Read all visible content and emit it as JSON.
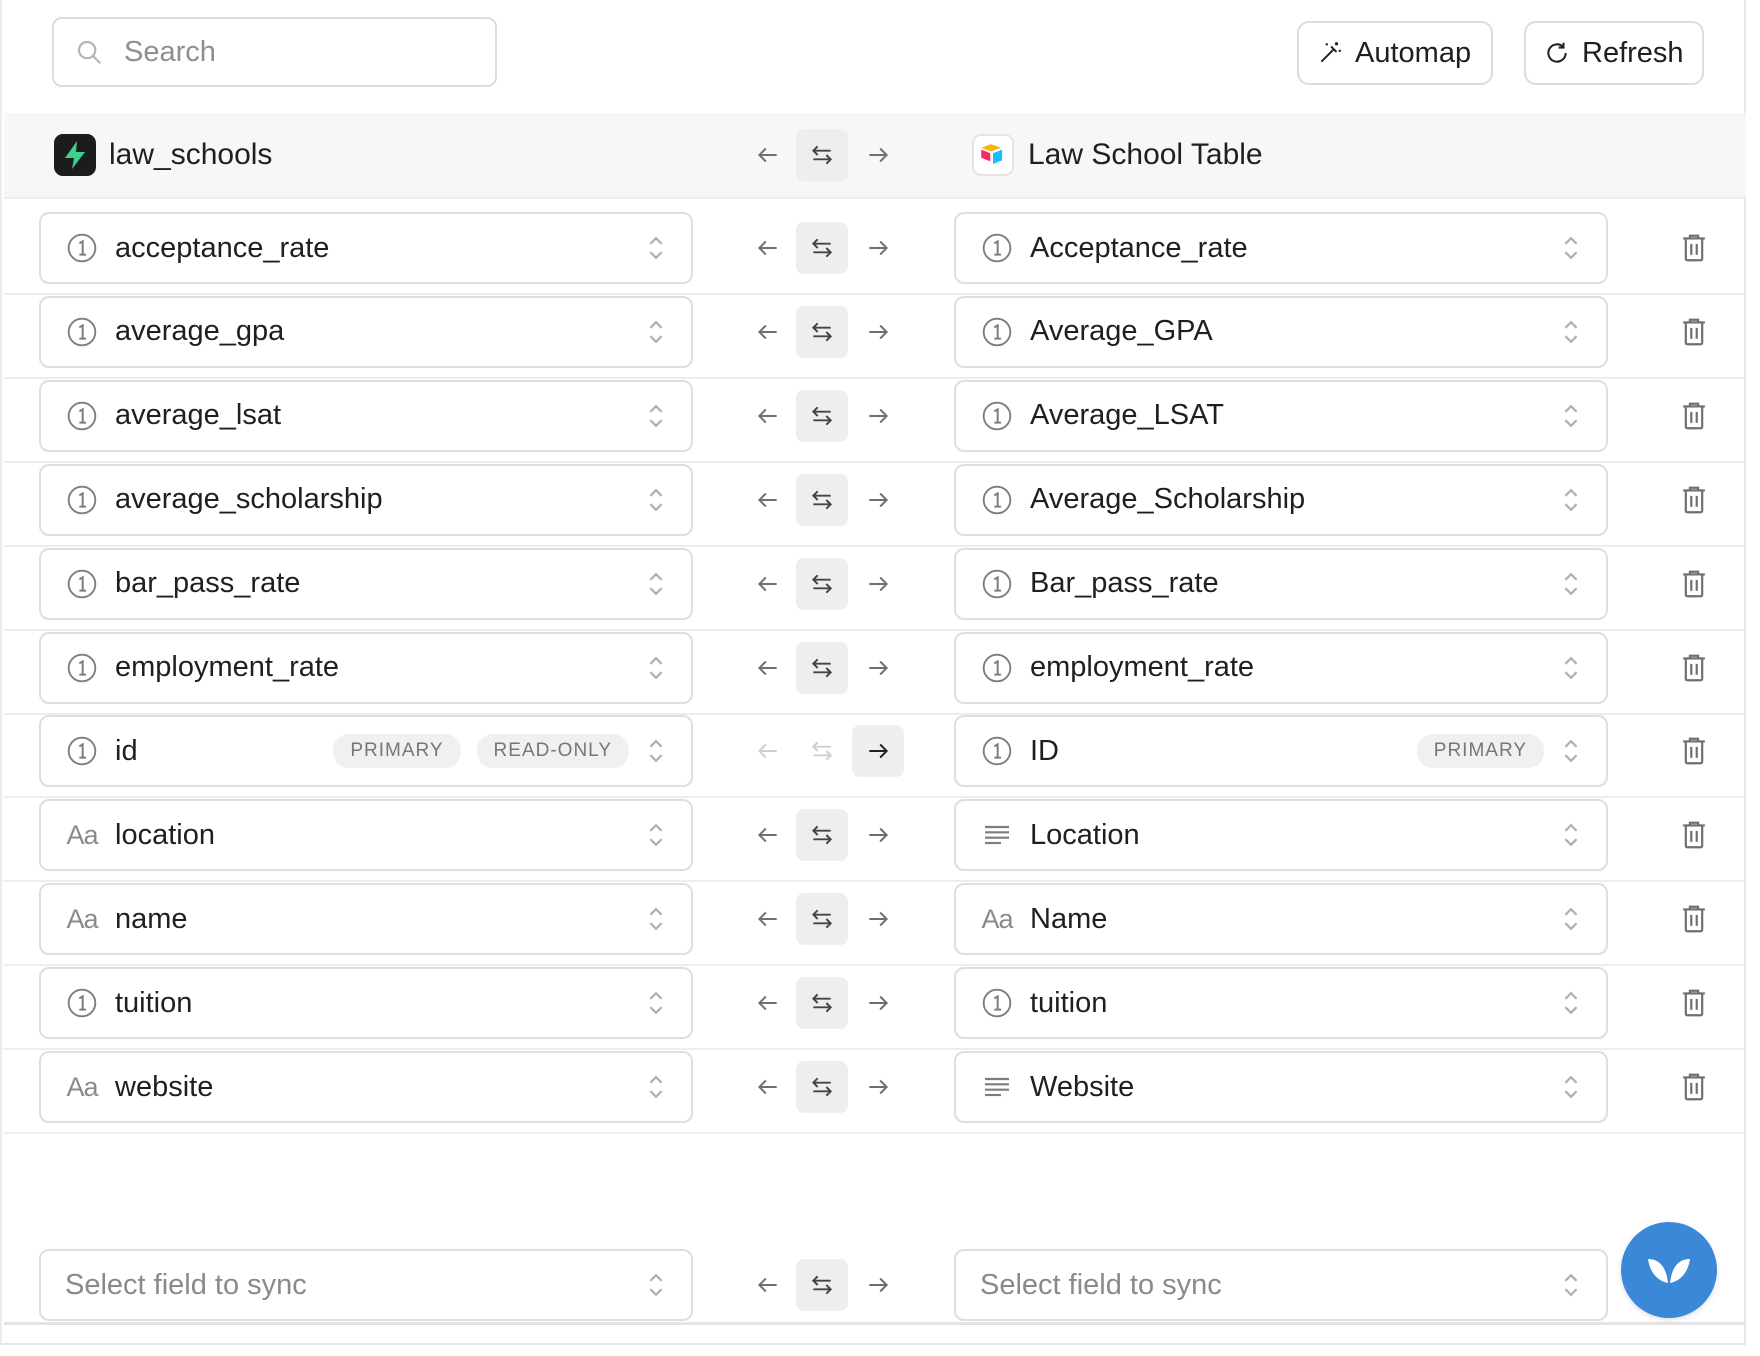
{
  "toolbar": {
    "search_placeholder": "Search",
    "automap_label": "Automap",
    "refresh_label": "Refresh"
  },
  "header": {
    "source_name": "law_schools",
    "destination_name": "Law School Table"
  },
  "rows": [
    {
      "left": {
        "type": "number",
        "name": "acceptance_rate"
      },
      "right": {
        "type": "number",
        "name": "Acceptance_rate"
      }
    },
    {
      "left": {
        "type": "number",
        "name": "average_gpa"
      },
      "right": {
        "type": "number",
        "name": "Average_GPA"
      }
    },
    {
      "left": {
        "type": "number",
        "name": "average_lsat"
      },
      "right": {
        "type": "number",
        "name": "Average_LSAT"
      }
    },
    {
      "left": {
        "type": "number",
        "name": "average_scholarship"
      },
      "right": {
        "type": "number",
        "name": "Average_Scholarship"
      }
    },
    {
      "left": {
        "type": "number",
        "name": "bar_pass_rate"
      },
      "right": {
        "type": "number",
        "name": "Bar_pass_rate"
      }
    },
    {
      "left": {
        "type": "number",
        "name": "employment_rate"
      },
      "right": {
        "type": "number",
        "name": "employment_rate"
      }
    },
    {
      "left": {
        "type": "number",
        "name": "id",
        "badges": [
          "PRIMARY",
          "READ-ONLY"
        ]
      },
      "right": {
        "type": "number",
        "name": "ID",
        "badges": [
          "PRIMARY"
        ]
      },
      "direction": "one-way"
    },
    {
      "left": {
        "type": "text",
        "name": "location"
      },
      "right": {
        "type": "long-text",
        "name": "Location"
      }
    },
    {
      "left": {
        "type": "text",
        "name": "name"
      },
      "right": {
        "type": "text",
        "name": "Name"
      }
    },
    {
      "left": {
        "type": "number",
        "name": "tuition"
      },
      "right": {
        "type": "number",
        "name": "tuition"
      }
    },
    {
      "left": {
        "type": "text",
        "name": "website"
      },
      "right": {
        "type": "long-text",
        "name": "Website"
      }
    }
  ],
  "new_row": {
    "left_placeholder": "Select field to sync",
    "right_placeholder": "Select field to sync"
  },
  "icons": {
    "text_type_glyph": "Aa"
  },
  "colors": {
    "fab": "#3b88d8",
    "header_band": "#f7f7f7",
    "field_border": "#dedede"
  }
}
